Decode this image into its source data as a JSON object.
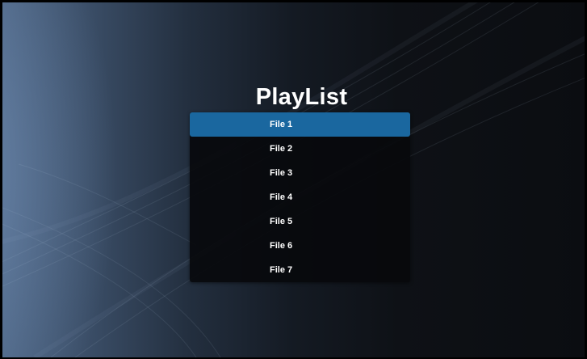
{
  "app": {
    "title": "PlayList"
  },
  "playlist": {
    "selected_index": 0,
    "items": [
      {
        "label": "File 1"
      },
      {
        "label": "File 2"
      },
      {
        "label": "File 3"
      },
      {
        "label": "File 4"
      },
      {
        "label": "File 5"
      },
      {
        "label": "File 6"
      },
      {
        "label": "File 7"
      }
    ]
  },
  "colors": {
    "selection": "#1a679f",
    "text": "#ffffff",
    "list_background": "#08090c"
  }
}
